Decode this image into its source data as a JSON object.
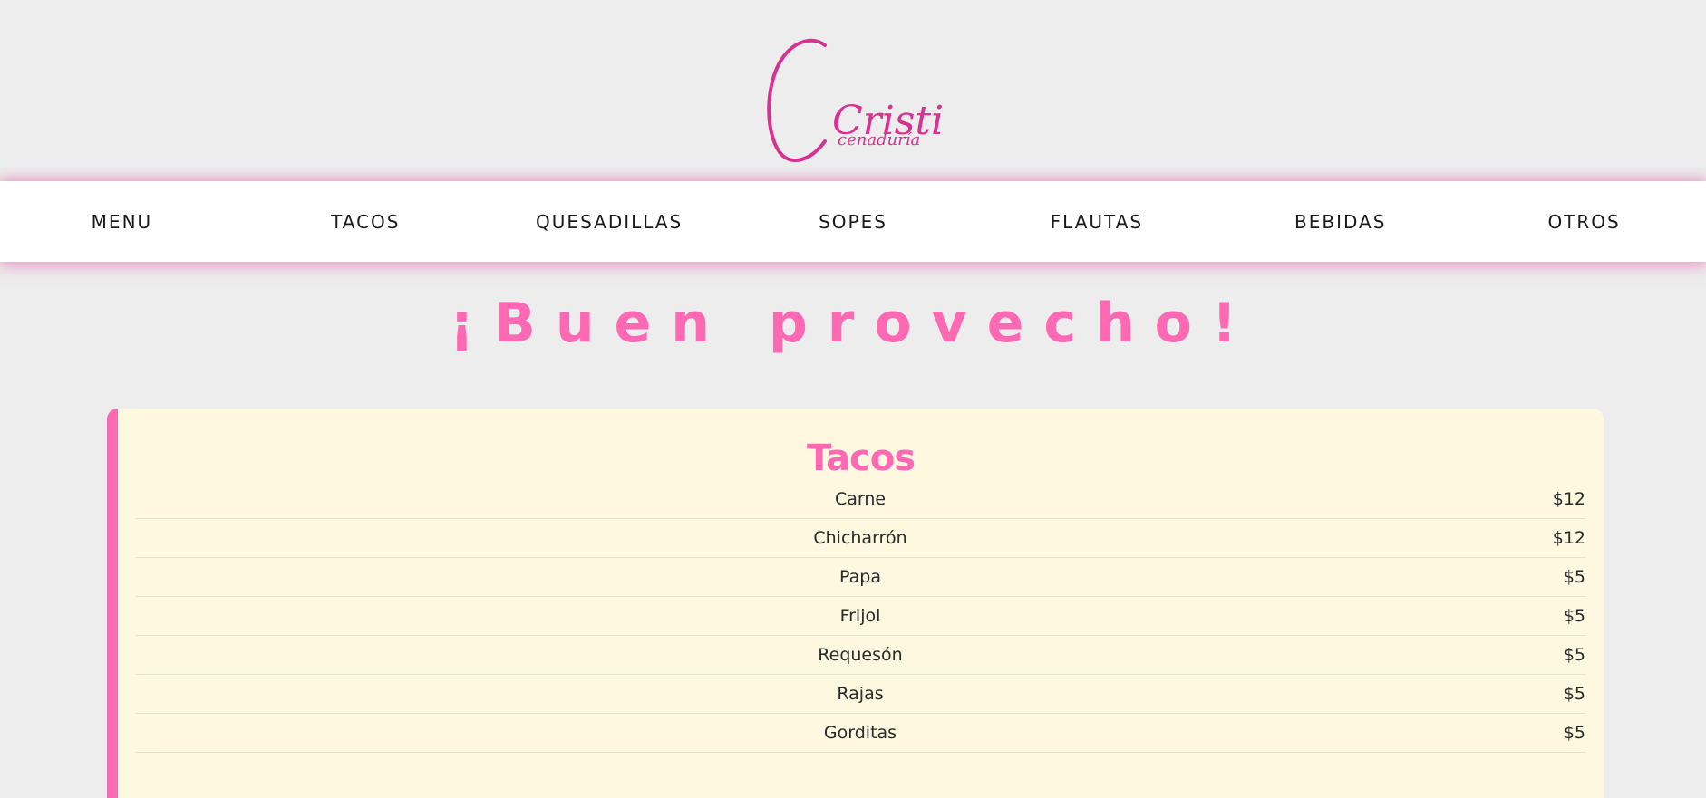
{
  "brand": {
    "logo_main": "Cristi",
    "logo_sub": "cenaduría",
    "accent_color": "#ff69b4",
    "logo_color": "#d63391"
  },
  "nav": {
    "items": [
      {
        "label": "MENU"
      },
      {
        "label": "TACOS"
      },
      {
        "label": "QUESADILLAS"
      },
      {
        "label": "SOPES"
      },
      {
        "label": "FLAUTAS"
      },
      {
        "label": "BEBIDAS"
      },
      {
        "label": "OTROS"
      }
    ]
  },
  "hero": {
    "headline": "¡Buen provecho!"
  },
  "menu_section": {
    "title": "Tacos",
    "items": [
      {
        "name": "Carne",
        "price": "$12"
      },
      {
        "name": "Chicharrón",
        "price": "$12"
      },
      {
        "name": "Papa",
        "price": "$5"
      },
      {
        "name": "Frijol",
        "price": "$5"
      },
      {
        "name": "Requesón",
        "price": "$5"
      },
      {
        "name": "Rajas",
        "price": "$5"
      },
      {
        "name": "Gorditas",
        "price": "$5"
      }
    ]
  }
}
